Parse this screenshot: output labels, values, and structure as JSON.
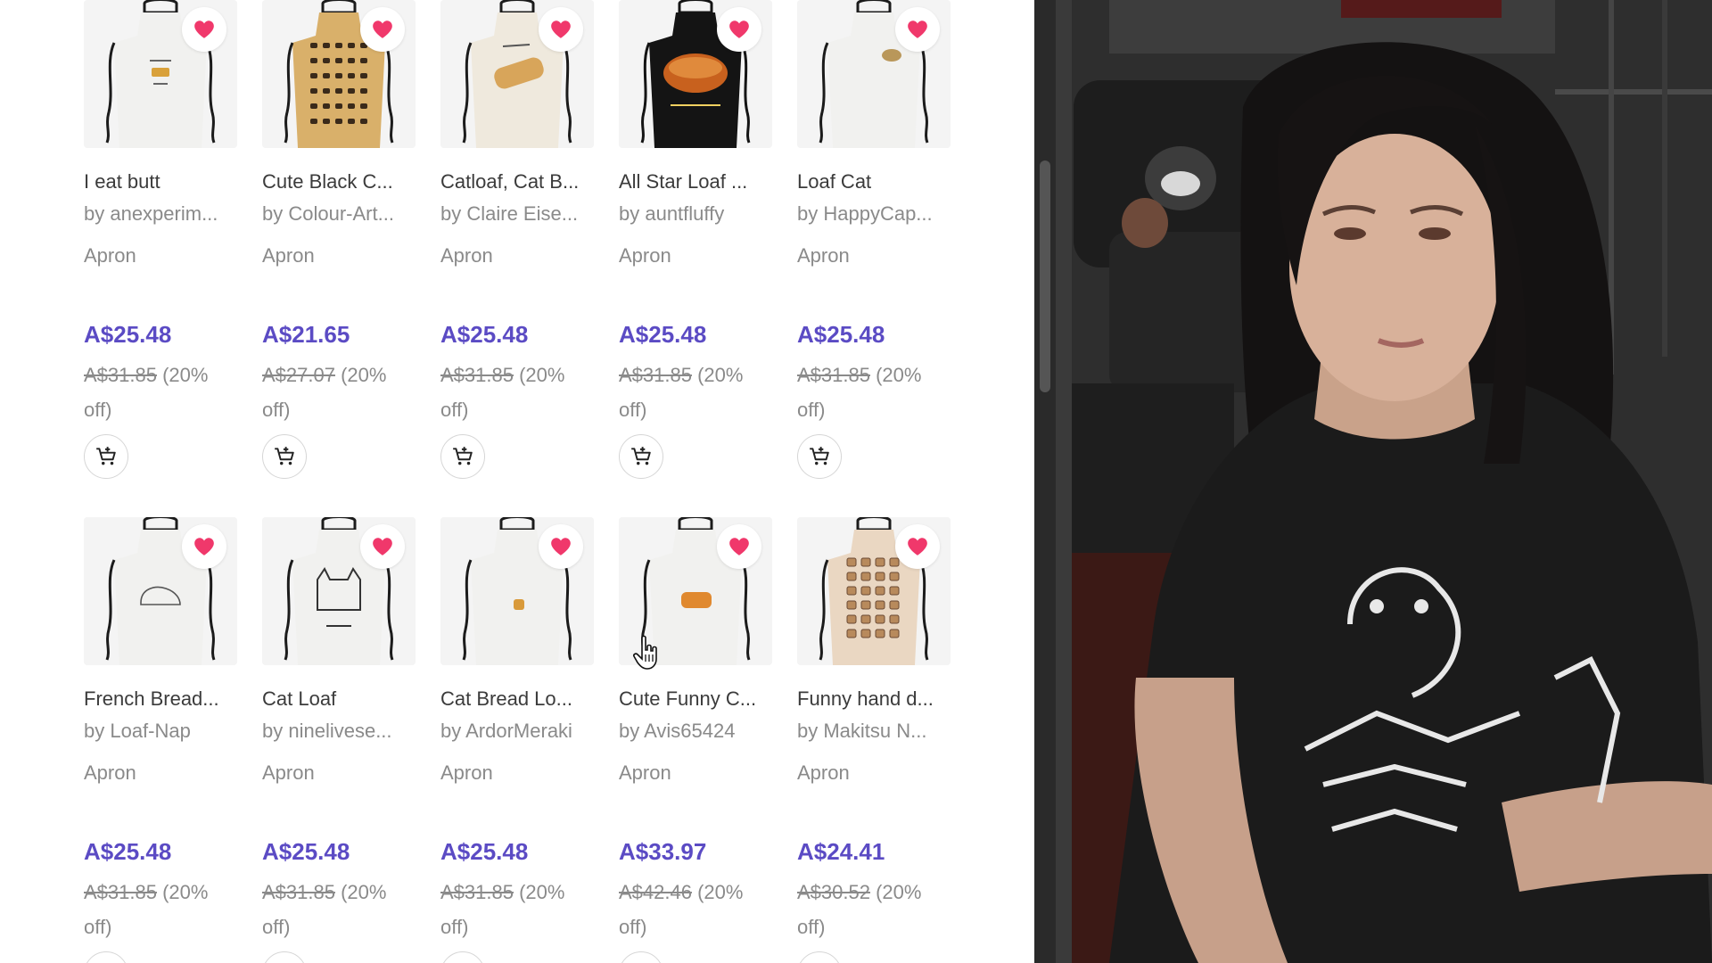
{
  "products": [
    {
      "title": "I eat butt",
      "artist": "by anexperim...",
      "type": "Apron",
      "price": "A$25.48",
      "original_price": "A$31.85",
      "discount": "(20%",
      "discount_tail": "off)",
      "bg": "#f4f4f4",
      "apron": "#f1f1ef",
      "straps": "#1b1b1b",
      "art": "text"
    },
    {
      "title": "Cute Black C...",
      "artist": "by Colour-Art...",
      "type": "Apron",
      "price": "A$21.65",
      "original_price": "A$27.07",
      "discount": "(20%",
      "discount_tail": "off)",
      "bg": "#f4f4f4",
      "apron": "#d9b06a",
      "straps": "#1b1b1b",
      "art": "pattern"
    },
    {
      "title": "Catloaf, Cat B...",
      "artist": "by Claire Eise...",
      "type": "Apron",
      "price": "A$25.48",
      "original_price": "A$31.85",
      "discount": "(20%",
      "discount_tail": "off)",
      "bg": "#f4f4f4",
      "apron": "#efe9dd",
      "straps": "#1b1b1b",
      "art": "loaf"
    },
    {
      "title": "All Star Loaf ...",
      "artist": "by auntfluffy",
      "type": "Apron",
      "price": "A$25.48",
      "original_price": "A$31.85",
      "discount": "(20%",
      "discount_tail": "off)",
      "bg": "#f4f4f4",
      "apron": "#141414",
      "straps": "#141414",
      "art": "bigloaf"
    },
    {
      "title": "Loaf Cat",
      "artist": "by HappyCap...",
      "type": "Apron",
      "price": "A$25.48",
      "original_price": "A$31.85",
      "discount": "(20%",
      "discount_tail": "off)",
      "bg": "#f4f4f4",
      "apron": "#f1f1ef",
      "straps": "#1b1b1b",
      "art": "smallcat"
    },
    {
      "title": "French Bread...",
      "artist": "by Loaf-Nap",
      "type": "Apron",
      "price": "A$25.48",
      "original_price": "A$31.85",
      "discount": "(20%",
      "discount_tail": "off)",
      "bg": "#f4f4f4",
      "apron": "#f1f1ef",
      "straps": "#1b1b1b",
      "art": "outline"
    },
    {
      "title": "Cat Loaf",
      "artist": "by ninelivese...",
      "type": "Apron",
      "price": "A$25.48",
      "original_price": "A$31.85",
      "discount": "(20%",
      "discount_tail": "off)",
      "bg": "#f4f4f4",
      "apron": "#f1f1ef",
      "straps": "#1b1b1b",
      "art": "catsketch"
    },
    {
      "title": "Cat Bread Lo...",
      "artist": "by ArdorMeraki",
      "type": "Apron",
      "price": "A$25.48",
      "original_price": "A$31.85",
      "discount": "(20%",
      "discount_tail": "off)",
      "bg": "#f4f4f4",
      "apron": "#f1f1ef",
      "straps": "#1b1b1b",
      "art": "tiny"
    },
    {
      "title": "Cute Funny C...",
      "artist": "by Avis65424",
      "type": "Apron",
      "price": "A$33.97",
      "original_price": "A$42.46",
      "discount": "(20%",
      "discount_tail": "off)",
      "bg": "#f4f4f4",
      "apron": "#f1f1ef",
      "straps": "#1b1b1b",
      "art": "orangeloaf"
    },
    {
      "title": "Funny hand d...",
      "artist": "by Makitsu N...",
      "type": "Apron",
      "price": "A$24.41",
      "original_price": "A$30.52",
      "discount": "(20%",
      "discount_tail": "off)",
      "bg": "#f4f4f4",
      "apron": "#ead7c2",
      "straps": "#1b1b1b",
      "art": "breadpattern"
    }
  ],
  "icons": {
    "favorite": "heart-icon",
    "cart": "add-to-cart-icon",
    "cursor": "hand-pointer-icon"
  },
  "colors": {
    "accent_price": "#5b4bc4",
    "favorite": "#f0386b",
    "muted_text": "#8a8a8a"
  }
}
